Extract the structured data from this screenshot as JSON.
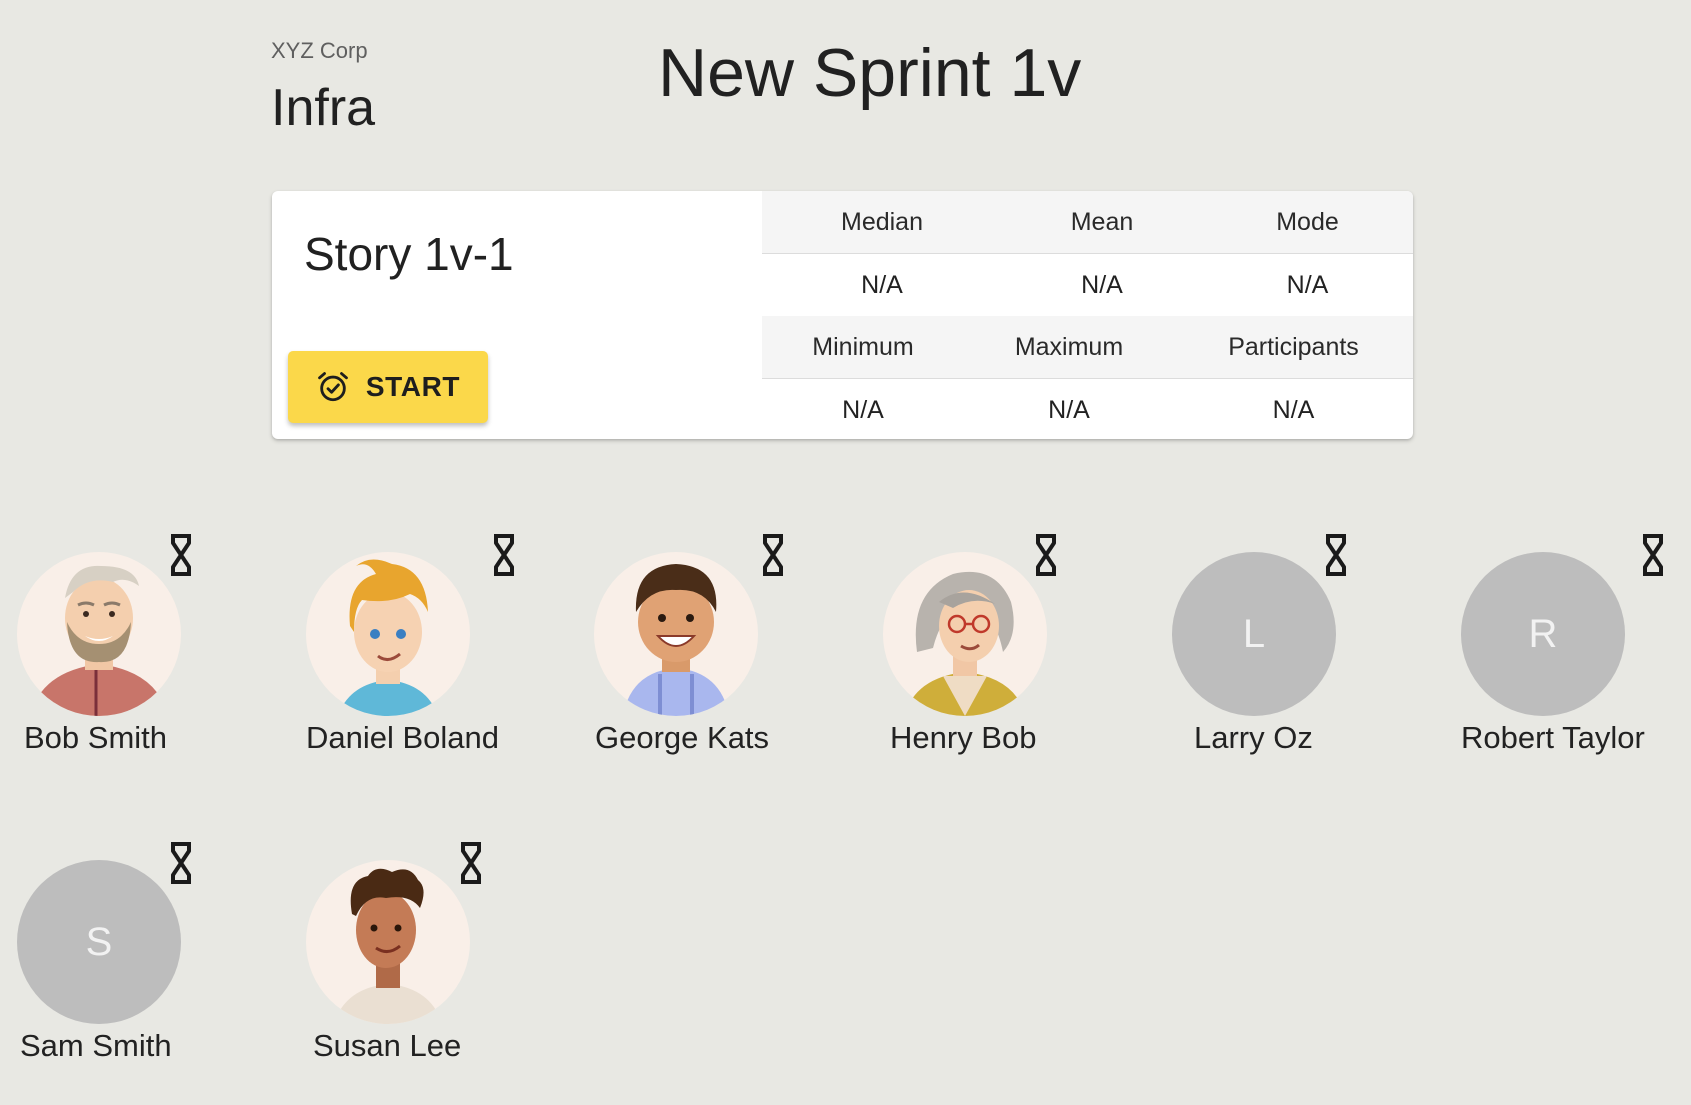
{
  "header": {
    "organization": "XYZ Corp",
    "team": "Infra",
    "sprint_title": "New Sprint 1v"
  },
  "story": {
    "name": "Story 1v-1",
    "start_label": "START",
    "start_icon": "alarm-clock-check-icon",
    "button_color": "#fbd84a",
    "stats": {
      "row1_headers": [
        "Median",
        "Mean",
        "Mode"
      ],
      "row1_values": [
        "N/A",
        "N/A",
        "N/A"
      ],
      "row2_headers": [
        "Minimum",
        "Maximum",
        "Participants"
      ],
      "row2_values": [
        "N/A",
        "N/A",
        "N/A"
      ]
    }
  },
  "participants": [
    {
      "name": "Bob Smith",
      "avatar": "cartoon-older-man-beard",
      "status_icon": "hourglass-icon"
    },
    {
      "name": "Daniel Boland",
      "avatar": "cartoon-blonde-boy",
      "status_icon": "hourglass-icon"
    },
    {
      "name": "George Kats",
      "avatar": "cartoon-boy-hoodie",
      "status_icon": "hourglass-icon"
    },
    {
      "name": "Henry Bob",
      "avatar": "cartoon-older-woman-glasses",
      "status_icon": "hourglass-icon"
    },
    {
      "name": "Larry Oz",
      "initial": "L",
      "status_icon": "hourglass-icon"
    },
    {
      "name": "Robert Taylor",
      "initial": "R",
      "status_icon": "hourglass-icon"
    },
    {
      "name": "Sam Smith",
      "initial": "S",
      "status_icon": "hourglass-icon"
    },
    {
      "name": "Susan Lee",
      "avatar": "cartoon-curly-hair-man",
      "status_icon": "hourglass-icon"
    }
  ]
}
